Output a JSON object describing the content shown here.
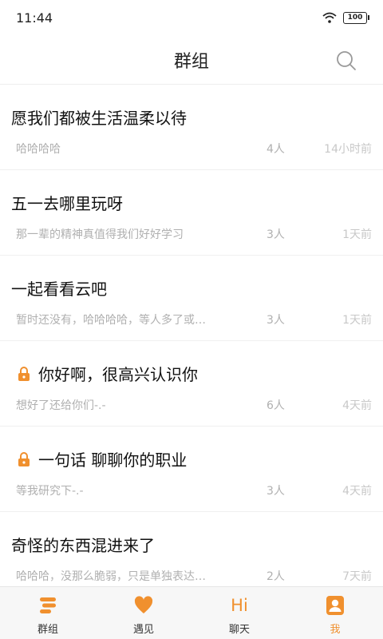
{
  "status_bar": {
    "time": "11:44",
    "battery": "100"
  },
  "header": {
    "title": "群组"
  },
  "groups": [
    {
      "title": "愿我们都被生活温柔以待",
      "preview": "哈哈哈哈",
      "count": "4人",
      "time": "14小时前",
      "locked": false
    },
    {
      "title": "五一去哪里玩呀",
      "preview": "那一辈的精神真值得我们好好学习",
      "count": "3人",
      "time": "1天前",
      "locked": false
    },
    {
      "title": "一起看看云吧",
      "preview": "暂时还没有，哈哈哈哈，等人多了或…",
      "count": "3人",
      "time": "1天前",
      "locked": false
    },
    {
      "title": "你好啊，很高兴认识你",
      "preview": "想好了还给你们-.-",
      "count": "6人",
      "time": "4天前",
      "locked": true
    },
    {
      "title": "一句话 聊聊你的职业",
      "preview": "等我研究下-.-",
      "count": "3人",
      "time": "4天前",
      "locked": true
    },
    {
      "title": "奇怪的东西混进来了",
      "preview": "哈哈哈，没那么脆弱，只是单独表达…",
      "count": "2人",
      "time": "7天前",
      "locked": false
    }
  ],
  "tabs": [
    {
      "label": "群组",
      "icon": "list-icon"
    },
    {
      "label": "遇见",
      "icon": "heart-icon"
    },
    {
      "label": "聊天",
      "icon": "hi-icon",
      "glyph": "Hi"
    },
    {
      "label": "我",
      "icon": "profile-icon",
      "active": true
    }
  ],
  "colors": {
    "accent": "#f0902e",
    "muted_text": "#b0b0b0",
    "title_text": "#111111"
  }
}
